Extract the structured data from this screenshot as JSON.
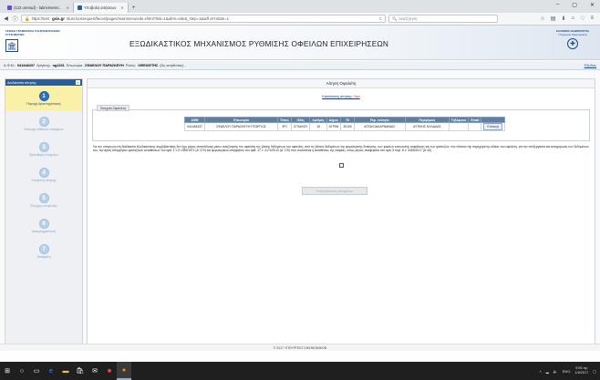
{
  "browser": {
    "tabs": [
      {
        "label": "(123 unread) - labrivimeter..."
      },
      {
        "label": "Υποβολή αιτήσεων"
      }
    ],
    "url_prefix": "https://test.",
    "url_host": "gsis.gr",
    "url_rest": "/dusc/oosrequest/faces/pages/mainmenu/ede.xhtml?link=1&afrm=ede&_step=1&adf.ctrl-state=1",
    "search_placeholder": "Αναζήτηση"
  },
  "header": {
    "left_logo_text": "ΓΕΝΙΚΗ ΓΡΑΜΜΑΤΕΙΑ ΠΛΗΡΟΦΟΡΙΑΚΩΝ ΣΥΣΤΗΜΑΤΩΝ",
    "title": "ΕΞΩΔΙΚΑΣΤΙΚΟΣ ΜΗΧΑΝΙΣΜΟΣ ΡΥΘΜΙΣΗΣ ΟΦΕΙΛΩΝ ΕΠΙΧΕΙΡΗΣΕΩΝ",
    "right_logo_line1": "ΕΛΛΗΝΙΚΗ ΔΗΜΟΚΡΑΤΙΑ",
    "right_logo_line2": "Υπουργείο Οικονομικών"
  },
  "userbar": {
    "afm_label": "Α.Φ.Μ.:",
    "afm": "041448437",
    "user_label": "Χρήστης:",
    "user": "ng1201",
    "name_label": "Επωνυμία:",
    "name": "ΣΦΑΕΛΟΥ ΠΑΡΑΣΚΕΥΗ",
    "role_label": "Ρόλος:",
    "role": "ΟΦΕΙΛΕΤΗΣ",
    "role_suffix": "(Ως αιτηθέντας) -",
    "exit": "Έξοδος"
  },
  "sidebar": {
    "title": "Διαδικασία αίτησης",
    "steps": [
      {
        "num": "1",
        "label": "Παροχή Δραστηριότητας"
      },
      {
        "num": "2",
        "label": "Επιλογή πιθανών στοιχείων"
      },
      {
        "num": "3",
        "label": "Προσθήκη στοιχείων"
      },
      {
        "num": "4",
        "label": "Υποβολή αίτησης"
      },
      {
        "num": "5",
        "label": "Έλεγχος υποβολής"
      },
      {
        "num": "6",
        "label": "Διαπραγμάτευση"
      },
      {
        "num": "7",
        "label": "Απόφαση"
      }
    ]
  },
  "main": {
    "title": "Αίτηση Οφειλέτη",
    "status_label": "Κατάσταση αίτησης:",
    "status_value": "Νέα",
    "fieldset_title": "Στοιχεία Οφειλέτη",
    "table": {
      "headers": [
        "ΑΦΜ",
        "Επωνυμία",
        "Τύπος",
        "Οδός",
        "Αριθμός",
        "Δήμος",
        "ΤΚ",
        "Περ. ενότητα",
        "Περιφέρεια",
        "Τηλέφωνο",
        "Email",
        ""
      ],
      "row": [
        "041448437",
        "ΣΦΑΕΛΟΥ ΠΑΡΑΣΚΕΥΗ ΓΕΩΡΓΙΟΣ",
        "ΦΠ",
        "ΙΣΤΙΑΚΟΥ",
        "15",
        "ΑΓΡΙΝΙ",
        "30100",
        "ΑΙΤΩΛΟΑΚΑΡΝΑΝΙΑΣ",
        "ΔΥΤΙΚΗΣ ΕΛΛΑΔΑΣ",
        "",
        ""
      ],
      "select_label": "Επιλογή"
    },
    "legal_text": "Για την υπαγωγή στη διαδικασία εξωδικαστικής συμβιβαστικής δεν έχω μέρος αντιπάλλαγή μέσω αναζήτησης του οφειλέτη της βάσης δεδομένων του οφειλέτη, από τις βάσεις δεδομένων της φορολογικής διοίκησης, των φορέων κοινωνικής ασφάλισης και των τραπεζών, στο πλαίσιο της παρεχόμενης αδείας του οφειλέτη, για την επεξεργασία και κατοχύρωση των δεδομένων του, την άρση απορρήτου τραπεζικών καταθέσεων του αρθ. 1 ν.δ 1059/1971 (Α' 270) και φορολογικού απορρήτου του αρθ. 17 ν. 4174/2013 (Α' 170) που συνιστάται ή καταθέσεις της εταιρίας, όπως ρητώς αναφέρεται στο αρθ. 5 παρ. 8 ν. 4469/2017 (Α' 62)",
    "submit": "Επιβεβαίωση στοιχείων"
  },
  "footer": "© 2017 ΥΠΟΥΡΓΕΙΟ ΟΙΚΟΝΟΜΙΚΩΝ",
  "taskbar": {
    "lang": "ENG",
    "time": "9:55 πμ",
    "date": "1/8/2017"
  },
  "colors": {
    "accent": "#2a73c2",
    "header_blue": "#1a4a8a",
    "active_step_bg": "#fbf0a8",
    "status_red": "#c0392b",
    "table_header": "#5e7fa6"
  }
}
